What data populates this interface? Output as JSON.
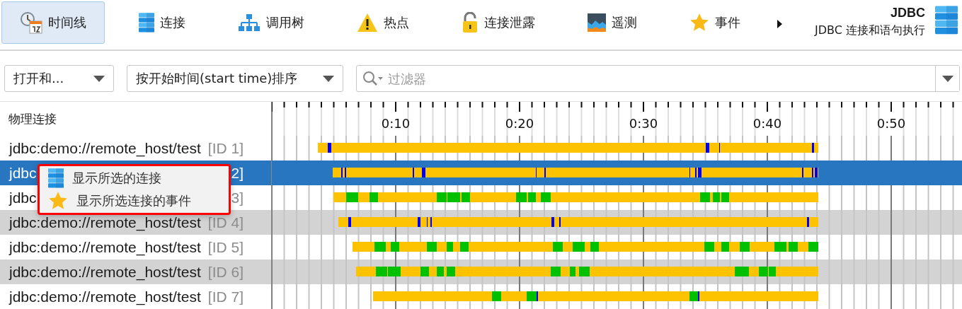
{
  "toolbar": {
    "tabs": [
      {
        "label": "时间线",
        "selected": true
      },
      {
        "label": "连接",
        "selected": false
      },
      {
        "label": "调用树",
        "selected": false
      },
      {
        "label": "热点",
        "selected": false
      },
      {
        "label": "连接泄露",
        "selected": false
      },
      {
        "label": "遥测",
        "selected": false
      },
      {
        "label": "事件",
        "selected": false
      }
    ],
    "title": "JDBC",
    "subtitle": "JDBC 连接和语句执行"
  },
  "filters": {
    "mode": "打开和...",
    "sort": "按开始时间(start time)排序",
    "search": {
      "placeholder": "过滤器"
    }
  },
  "list": {
    "heading": "物理连接",
    "axis_labels": [
      "0:10",
      "0:20",
      "0:30",
      "0:40",
      "0:50"
    ],
    "rows": [
      {
        "url": "jdbc:demo://remote_host/test",
        "id": "[ID 1]",
        "selected": false
      },
      {
        "url": "jdbc",
        "id": "2]",
        "selected": true
      },
      {
        "url": "jdbc",
        "id": "3]",
        "selected": false
      },
      {
        "url": "jdbc:demo://remote_host/test",
        "id": "[ID 4]",
        "selected": false
      },
      {
        "url": "jdbc:demo://remote_host/test",
        "id": "[ID 5]",
        "selected": false
      },
      {
        "url": "jdbc:demo://remote_host/test",
        "id": "[ID 6]",
        "selected": false
      },
      {
        "url": "jdbc:demo://remote_host/test",
        "id": "[ID 7]",
        "selected": false
      }
    ]
  },
  "context_menu": {
    "items": [
      {
        "label": "显示所选的连接"
      },
      {
        "label": "显示所选连接的事件"
      }
    ]
  }
}
